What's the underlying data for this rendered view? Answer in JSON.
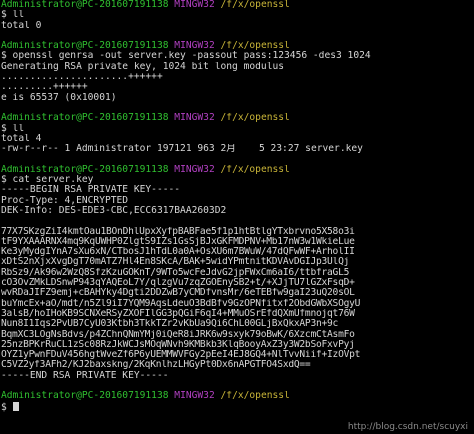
{
  "prompt": {
    "user_host": "Administrator@PC-201607191138",
    "system": "MINGW32",
    "path": "/f/x/openssl"
  },
  "session": [
    {
      "cmd": "$ ll",
      "output": [
        "total 0"
      ]
    },
    {
      "cmd": "$ openssl genrsa -out server.key -passout pass:123456 -des3 1024",
      "output": [
        "Generating RSA private key, 1024 bit long modulus",
        "......................++++++",
        ".........++++++",
        "e is 65537 (0x10001)"
      ]
    },
    {
      "cmd": "$ ll",
      "output": [
        "total 4",
        "-rw-r--r-- 1 Administrator 197121 963 2月    5 23:27 server.key"
      ]
    },
    {
      "cmd": "$ cat server.key",
      "output": [
        "-----BEGIN RSA PRIVATE KEY-----",
        "Proc-Type: 4,ENCRYPTED",
        "DEK-Info: DES-EDE3-CBC,ECC6317BAA2603D2",
        "",
        "77X7SKzgZiI4kmtOau1BOnDhlUpxXyfpBABFae5f1p1htBtlgYTxbrvno5X58o3i",
        "tF9YXAAARNX4mq9KqUWHP0ZlgtS9IZs1GsSjBJxGKFMDPNV+Mb17nW3w1WkieLue",
        "Ke3yMydgIYnA7sXu6xN/CTbosJ1hTdL0a0A+OsXU6m7BWuW/47dQFwWF+ArholII",
        "xDtS2nXjxXvgDgT70mATZ7Hl4En8SKcA/BAK+5widYPmtnitKDVAvDGIJp3UlQj",
        "RbSz9/Ak96w2WzQ8SfzKzuGOKnT/9WTo5wcFeJdvG2jpFWxCm6aI6/ttbfraGL5",
        "cO3OvZMkLDSnwP943qYAQEoL7Y/qlzgVu7zqZGOEnySB2+t/+XJjTU7lGZxFsqD+",
        "wvRDaJIFZ9emj+cBAHYky4Dgti2DDZwB7yCMDfvnsMr/6eTEBfw9gaI23uQ20sOL",
        "buYmcEx+aO/mdt/n5Zl9iI7YQM9AqsLdeuO3BdBfv9GzOPNfitxf2ObdGWbXSOgyU",
        "3alsB/hoIHoKB9SCNXeRSyZXOFIlGG3pQGiF6qI4+MMuOSrEfdQXmUfmnojqt76W",
        "Nun8I1Iqs2PvUB7CyU03Ktbh3TkkTZr2vKbUa9Qi6ChL00GLjBxQkxAP3n+9c",
        "BqmXC3LOgNsBdvs/p4ZChnQNmYMj0iQeR8iJRK6w9sxyk79oBwK/6XzcmCtAsmFo",
        "25nzBPKrRuCL1zSc08RzJkWCJsMOqWNvh9KMBkb3KlqBooyAxZ3y3W2bSoFxvPyj",
        "OYZ1yPwnFDuV456hgtWveZf6P6yUEMMWVFGy2pEeI4EJ8GQ4+NlTvvNiif+IzOVpt",
        "C5VZ2yf3AFh2/KJ2baxskng/2KqKnlhzLHGyPt0Dx6nAPGTFO4SxdQ==",
        "-----END RSA PRIVATE KEY-----"
      ]
    }
  ],
  "watermark": "http://blog.csdn.net/scuyxi",
  "colors": {
    "user": "#30c030",
    "system": "#b040c0",
    "path": "#c8b438",
    "text": "#d6d6d6",
    "background": "#000000"
  }
}
